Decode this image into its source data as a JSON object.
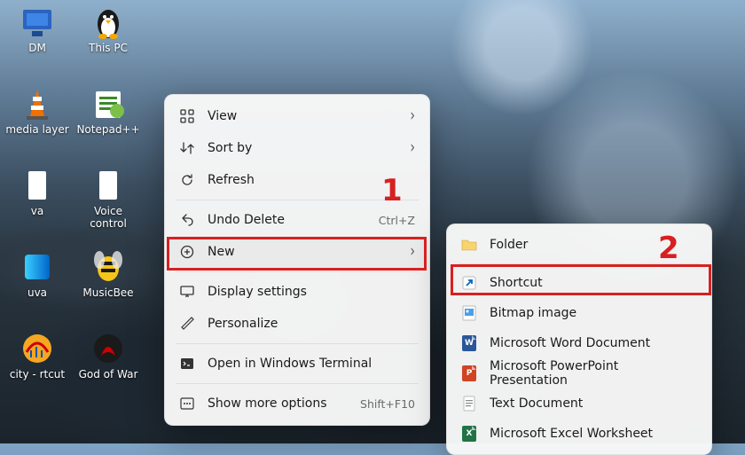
{
  "desktop_icons": [
    {
      "label": "DM"
    },
    {
      "label": "This PC"
    },
    {
      "label": "media layer"
    },
    {
      "label": "Notepad++"
    },
    {
      "label": "va"
    },
    {
      "label": "Voice control"
    },
    {
      "label": "uva"
    },
    {
      "label": "MusicBee"
    },
    {
      "label": "city - rtcut"
    },
    {
      "label": "God of War"
    }
  ],
  "menu": {
    "view": "View",
    "sort_by": "Sort by",
    "refresh": "Refresh",
    "undo_delete": "Undo Delete",
    "undo_delete_accel": "Ctrl+Z",
    "new": "New",
    "display_settings": "Display settings",
    "personalize": "Personalize",
    "open_terminal": "Open in Windows Terminal",
    "show_more": "Show more options",
    "show_more_accel": "Shift+F10"
  },
  "submenu": {
    "folder": "Folder",
    "shortcut": "Shortcut",
    "bitmap": "Bitmap image",
    "word": "Microsoft Word Document",
    "powerpoint": "Microsoft PowerPoint Presentation",
    "text": "Text Document",
    "excel": "Microsoft Excel Worksheet"
  },
  "annotations": {
    "one": "1",
    "two": "2"
  }
}
